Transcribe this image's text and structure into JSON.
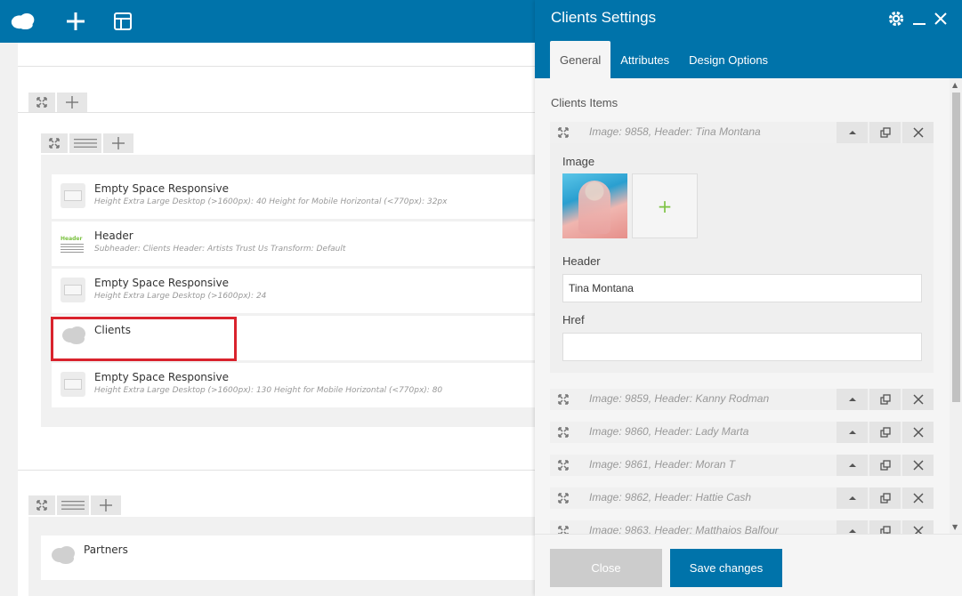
{
  "topbar": {
    "icons": [
      "logo-cloud-icon",
      "plus-icon",
      "layout-icon"
    ]
  },
  "canvas": {
    "elements": [
      {
        "title": "Empty Space Responsive",
        "subtitle": "Height Extra Large Desktop (>1600px): 40  Height for Mobile Horizontal (<770px): 32px",
        "icon": "empty-space-icon"
      },
      {
        "title": "Header",
        "subtitle": "Subheader: Clients  Header: Artists Trust Us  Transform: Default",
        "icon": "header-icon",
        "icon_text": "Header"
      },
      {
        "title": "Empty Space Responsive",
        "subtitle": "Height Extra Large Desktop (>1600px): 24",
        "icon": "empty-space-icon"
      },
      {
        "title": "Clients",
        "subtitle": "",
        "icon": "cloud-icon"
      },
      {
        "title": "Empty Space Responsive",
        "subtitle": "Height Extra Large Desktop (>1600px): 130  Height for Mobile Horizontal (<770px): 80",
        "icon": "empty-space-icon"
      }
    ],
    "partners": {
      "title": "Partners",
      "icon": "cloud-icon"
    }
  },
  "panel": {
    "title": "Clients Settings",
    "tabs": [
      {
        "label": "General",
        "active": true
      },
      {
        "label": "Attributes",
        "active": false
      },
      {
        "label": "Design Options",
        "active": false
      }
    ],
    "section_label": "Clients Items",
    "items": [
      "Image: 9858, Header: Tina Montana",
      "Image: 9859, Header: Kanny Rodman",
      "Image: 9860, Header: Lady Marta",
      "Image: 9861, Header: Moran T",
      "Image: 9862, Header: Hattie Cash",
      "Image: 9863, Header: Matthaios Balfour"
    ],
    "expanded": {
      "image_label": "Image",
      "header_label": "Header",
      "header_value": "Tina Montana",
      "href_label": "Href",
      "href_value": ""
    },
    "buttons": {
      "close": "Close",
      "save": "Save changes"
    }
  },
  "colors": {
    "brand": "#0073aa",
    "highlight": "#d9232d",
    "add_green": "#7cc242"
  }
}
